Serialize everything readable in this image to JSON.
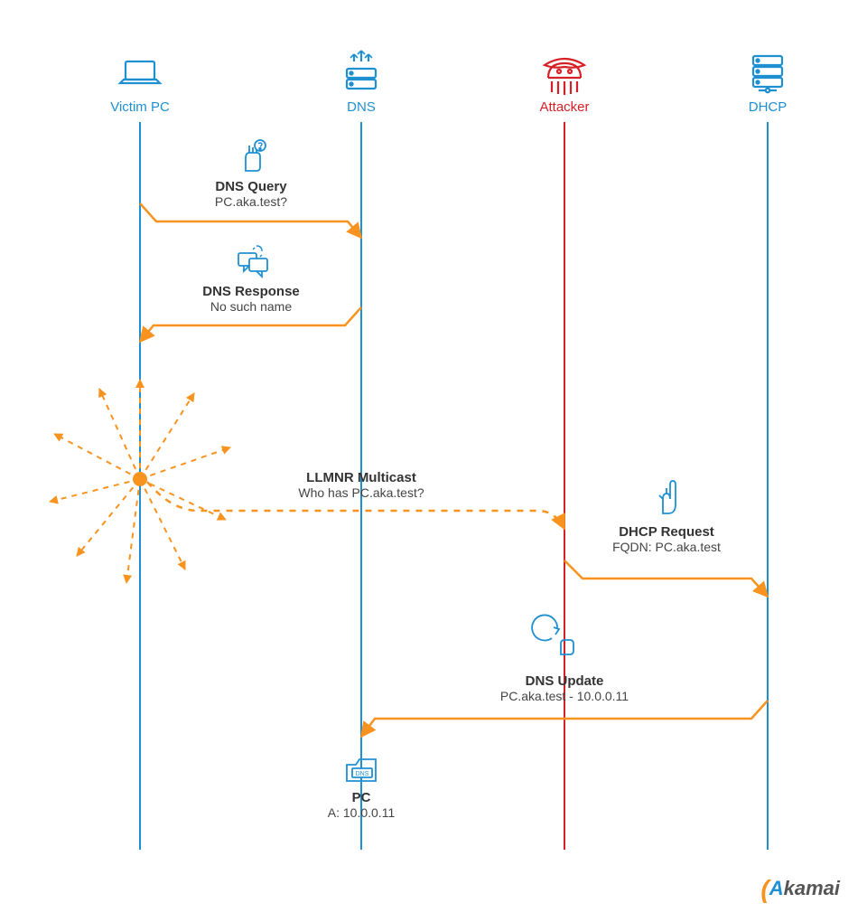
{
  "actors": {
    "victim": "Victim PC",
    "dns": "DNS",
    "attacker": "Attacker",
    "dhcp": "DHCP"
  },
  "messages": {
    "dnsQuery": {
      "title": "DNS Query",
      "sub": "PC.aka.test?"
    },
    "dnsResp": {
      "title": "DNS Response",
      "sub": "No such name"
    },
    "llmnr": {
      "title": "LLMNR Multicast",
      "sub": "Who has PC.aka.test?"
    },
    "dhcpReq": {
      "title": "DHCP Request",
      "sub": "FQDN: PC.aka.test"
    },
    "dnsUpdate": {
      "title": "DNS Update",
      "sub": "PC.aka.test - 10.0.0.11"
    },
    "record": {
      "title": "PC",
      "sub": "A: 10.0.0.11"
    }
  },
  "brand": {
    "name": "Akamai"
  },
  "colors": {
    "blue": "#1e90d2",
    "red": "#d62027",
    "orange": "#f7931e"
  }
}
